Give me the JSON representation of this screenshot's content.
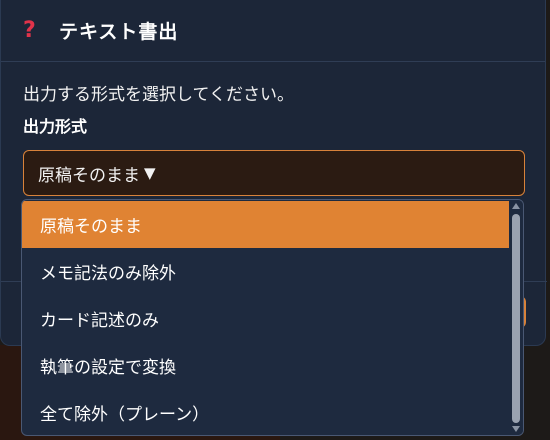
{
  "dialog": {
    "title": "テキスト書出",
    "icon": "question-mark-icon",
    "description": "出力する形式を選択してください。",
    "field_label": "出力形式",
    "select": {
      "value": "原稿そのまま",
      "arrow": "▼"
    },
    "options": [
      {
        "label": "原稿そのまま",
        "selected": true
      },
      {
        "label": "メモ記法のみ除外",
        "selected": false
      },
      {
        "label": "カード記述のみ",
        "selected": false
      },
      {
        "label": "執筆の設定で変換",
        "selected": false
      },
      {
        "label": "全て除外（プレーン）",
        "selected": false
      }
    ]
  },
  "colors": {
    "dialog_bg": "#1c2638",
    "accent": "#e08333",
    "select_border": "#d8823a",
    "danger_icon": "#e0334a"
  }
}
